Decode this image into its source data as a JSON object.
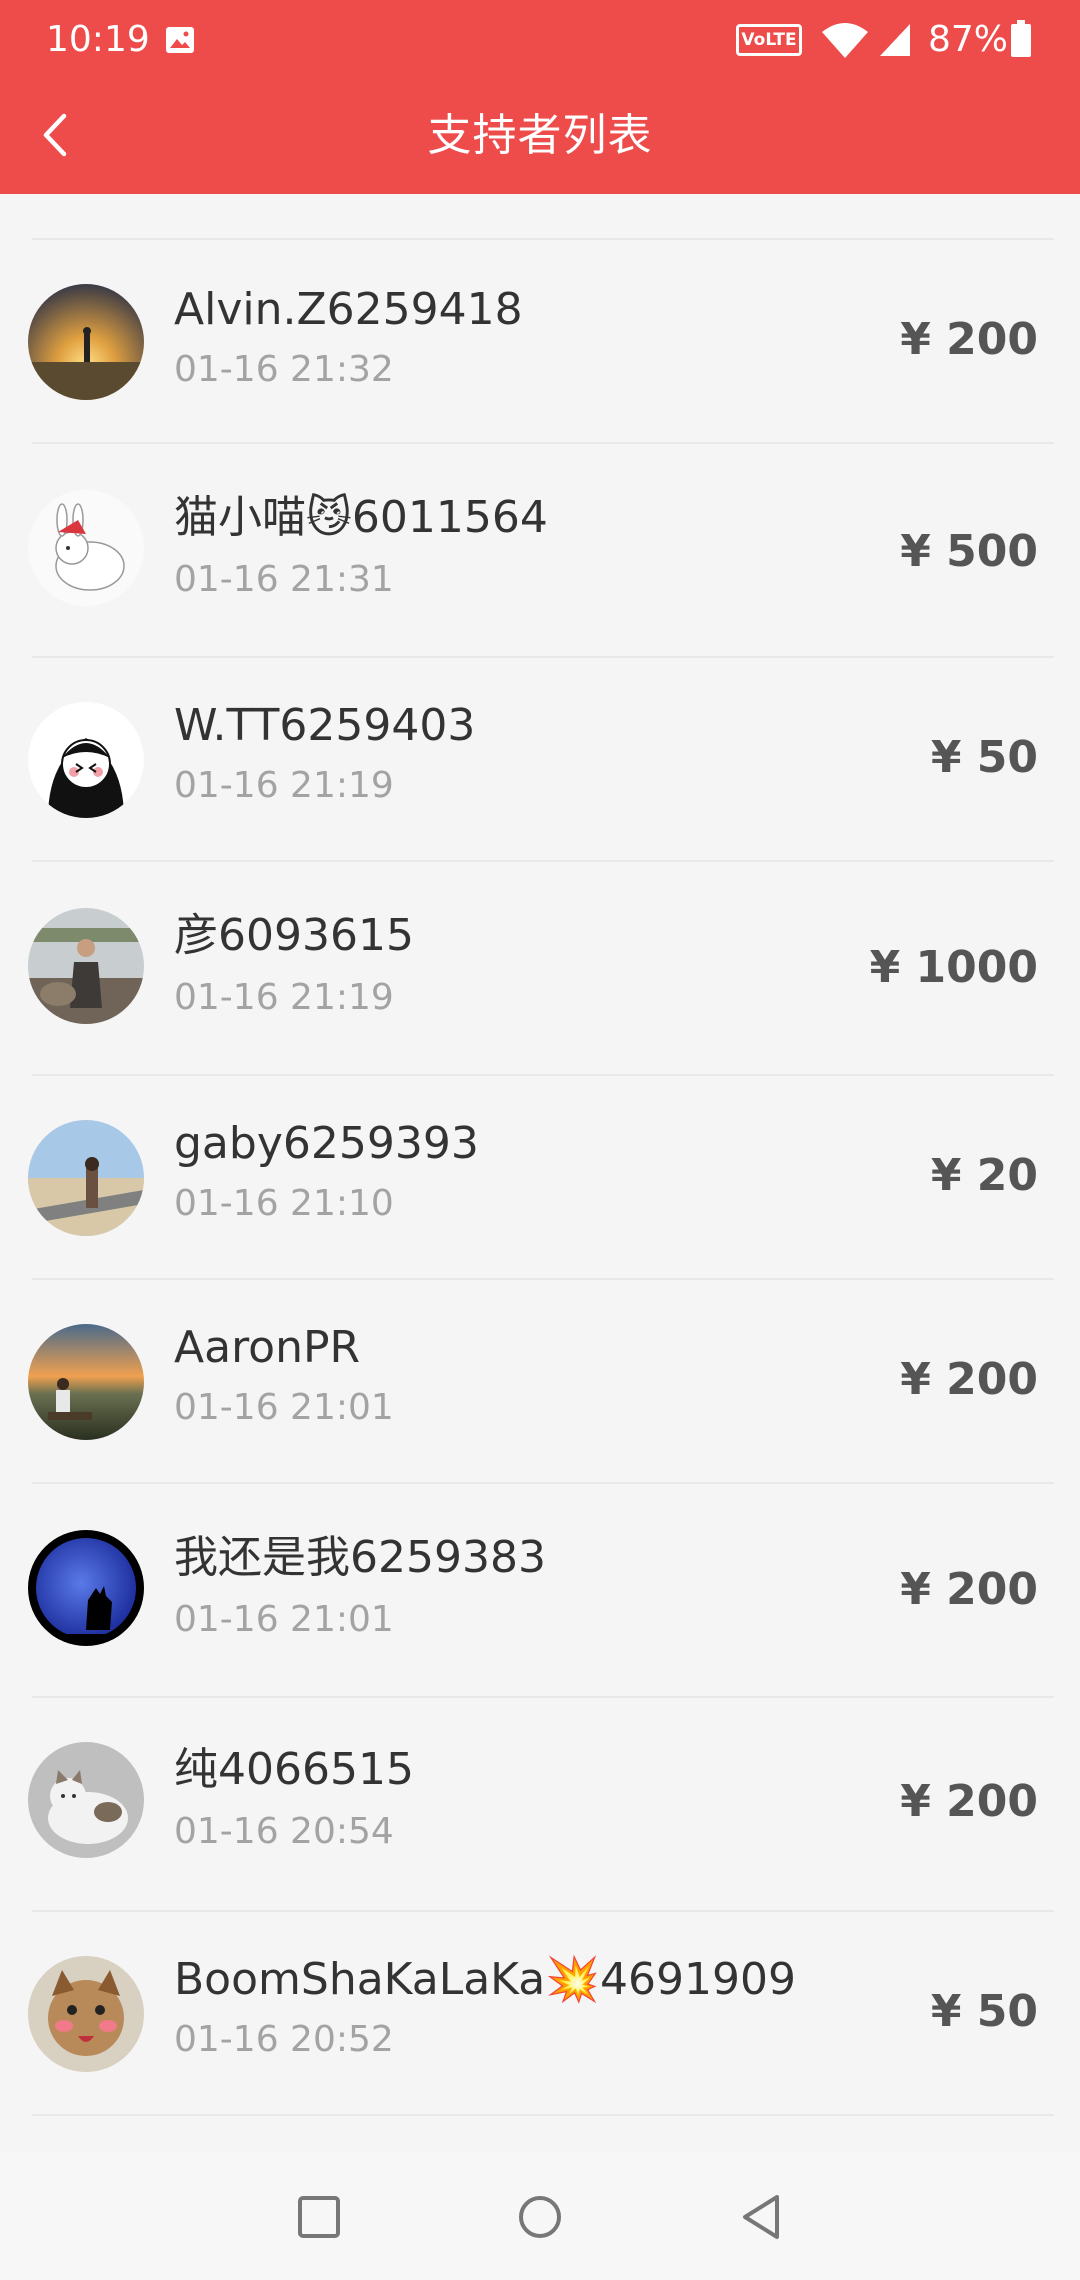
{
  "status_bar": {
    "time": "10:19",
    "network_badge": "VoLTE",
    "battery_percent": "87%",
    "icons": [
      "image-icon",
      "wifi-icon",
      "signal-icon",
      "battery-icon"
    ]
  },
  "title_bar": {
    "title": "支持者列表",
    "back_icon": "chevron-left-icon"
  },
  "supporters": [
    {
      "name": "Alvin.Z6259418",
      "time": "01-16 21:32",
      "amount": "¥ 200"
    },
    {
      "name": "猫小喵😼6011564",
      "time": "01-16 21:31",
      "amount": "¥ 500"
    },
    {
      "name": "W.TT6259403",
      "time": "01-16 21:19",
      "amount": "¥ 50"
    },
    {
      "name": "彦6093615",
      "time": "01-16 21:19",
      "amount": "¥ 1000"
    },
    {
      "name": "gaby6259393",
      "time": "01-16 21:10",
      "amount": "¥ 20"
    },
    {
      "name": "AaronPR",
      "time": "01-16 21:01",
      "amount": "¥ 200"
    },
    {
      "name": "我还是我6259383",
      "time": "01-16 21:01",
      "amount": "¥ 200"
    },
    {
      "name": "纯4066515",
      "time": "01-16 20:54",
      "amount": "¥ 200"
    },
    {
      "name": "BoomShaKaLaKa💥4691909",
      "time": "01-16 20:52",
      "amount": "¥ 50"
    }
  ],
  "nav_bar": {
    "buttons": [
      "square-recents-icon",
      "circle-home-icon",
      "triangle-back-icon"
    ]
  },
  "colors": {
    "header_bg": "#ee4b4b",
    "page_bg": "#f5f5f5",
    "name_text": "#333333",
    "time_text": "#a3a3a3",
    "amount_text": "#555555"
  }
}
